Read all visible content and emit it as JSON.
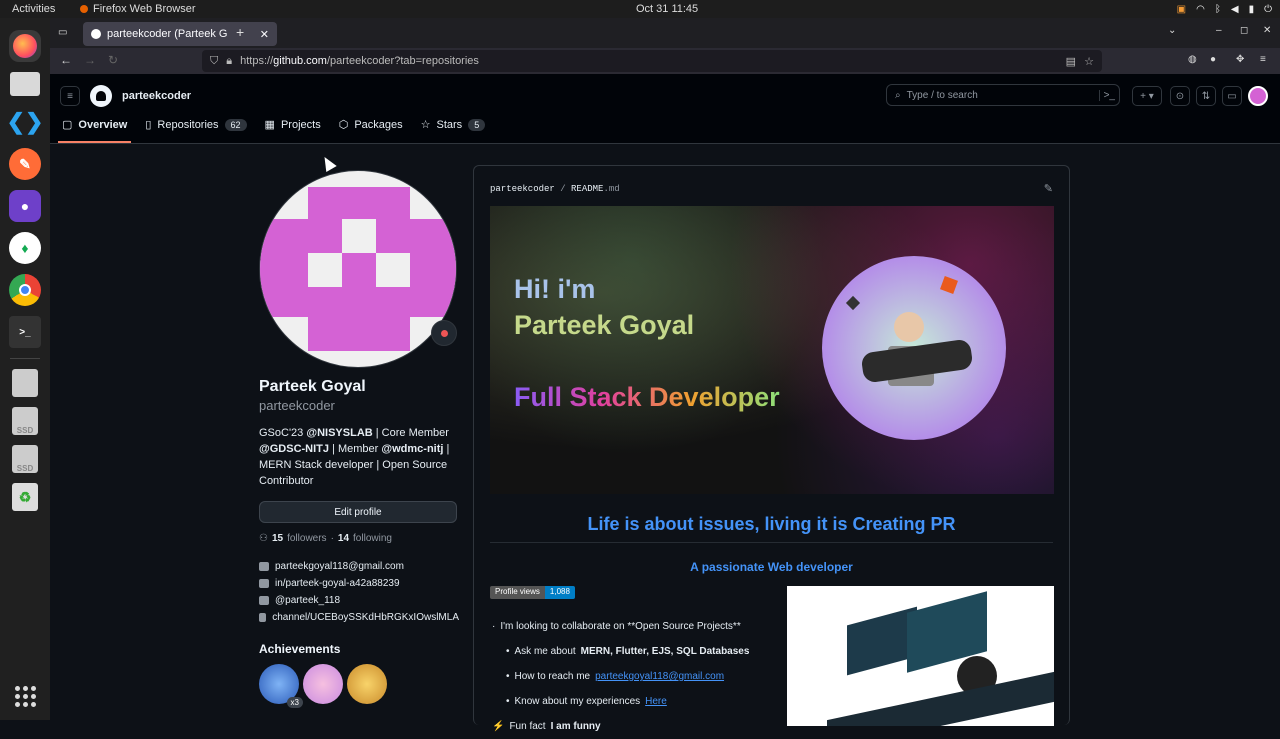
{
  "os": {
    "activities": "Activities",
    "app_name": "Firefox Web Browser",
    "clock": "Oct 31  11:45"
  },
  "browser": {
    "tab_title": "parteekcoder (Parteek G",
    "url_host": "github.com",
    "url_full": "https://github.com/parteekcoder?tab=repositories",
    "url_prefix": "https://",
    "url_path": "/parteekcoder?tab=repositories"
  },
  "github": {
    "username_header": "parteekcoder",
    "search_placeholder": "Type / to search",
    "nav": [
      {
        "label": "Overview",
        "count": ""
      },
      {
        "label": "Repositories",
        "count": "62"
      },
      {
        "label": "Projects",
        "count": ""
      },
      {
        "label": "Packages",
        "count": ""
      },
      {
        "label": "Stars",
        "count": "5"
      }
    ]
  },
  "profile": {
    "name": "Parteek Goyal",
    "login": "parteekcoder",
    "bio_1a": "GSoC'23 ",
    "bio_1b": "@NISYSLAB",
    "bio_1c": " | Core Member ",
    "bio_2a": "@GDSC-NITJ",
    "bio_2b": " | Member ",
    "bio_2c": "@wdmc-nitj",
    "bio_2d": " |",
    "bio_3": "MERN Stack developer | Open Source",
    "bio_4": "Contributor",
    "edit_label": "Edit profile",
    "followers": "15",
    "followers_label": "followers",
    "dot": "·",
    "following": "14",
    "following_label": "following",
    "email": "parteekgoyal118@gmail.com",
    "linkedin": "in/parteek-goyal-a42a88239",
    "twitter": "@parteek_118",
    "youtube": "channel/UCEBoySSKdHbRGKxIOwslMLA",
    "achievements_title": "Achievements",
    "achievement_multiplier": "x3"
  },
  "readme": {
    "owner": "parteekcoder",
    "sep": "/",
    "file": "README",
    "ext": ".md",
    "banner_line1": "Hi! i'm",
    "banner_line2": "Parteek Goyal",
    "banner_line3": "Full Stack Developer",
    "heading": "Life is about issues, living it is Creating PR",
    "subheading": "A passionate Web developer",
    "views_label": "Profile views",
    "views_count": "1,088",
    "b1": "I'm looking to collaborate on **Open Source Projects**",
    "b2a": "Ask me about ",
    "b2b": "MERN, Flutter, EJS, SQL Databases",
    "b3a": "How to reach me ",
    "b3b": "parteekgoyal118@gmail.com",
    "b4a": "Know about my experiences ",
    "b4b": "Here",
    "b5a": "Fun fact ",
    "b5b": "I am funny"
  }
}
